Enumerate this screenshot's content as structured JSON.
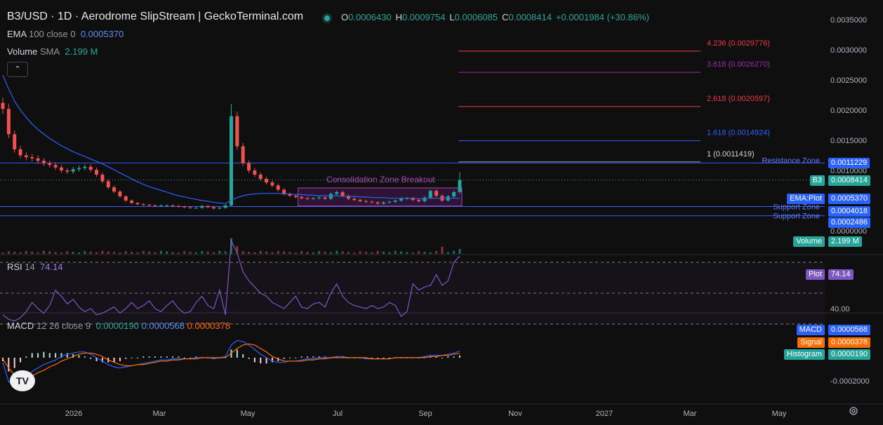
{
  "header": {
    "title": "B3/USD · 1D · Aerodrome SlipStream | GeckoTerminal.com",
    "ohlc": [
      {
        "k": "O",
        "v": "0.0006430"
      },
      {
        "k": "H",
        "v": "0.0009754"
      },
      {
        "k": "L",
        "v": "0.0006085"
      },
      {
        "k": "C",
        "v": "0.0008414"
      }
    ],
    "change": "+0.0001984 (+30.86%)"
  },
  "indicators": {
    "ema": {
      "name": "EMA",
      "params": "100 close 0",
      "value": "0.0005370"
    },
    "volume": {
      "name": "Volume",
      "params": "SMA",
      "value": "2.199 M"
    },
    "rsi": {
      "name": "RSI",
      "params": "14",
      "value": "74.14"
    },
    "macd": {
      "name": "MACD",
      "params": "12 26 close 9",
      "v1": "0.0000190",
      "v2": "0.0000568",
      "v3": "0.0000378"
    }
  },
  "collapse_icon": "chevron-up-icon",
  "colors": {
    "up": "#26a69a",
    "down": "#ef5350",
    "ema": "#2962ff",
    "zone": "#3d5afe",
    "fib_red": "#f23645",
    "fib_purple": "#9c27b0",
    "fib_blue": "#2962ff",
    "rsi": "#7e57c2",
    "macd": "#2962ff",
    "signal": "#ff6d00"
  },
  "chart_data": [
    {
      "type": "candlestick",
      "title": "B3/USD · 1D · Aerodrome SlipStream | GeckoTerminal.com",
      "x_ticks": [
        "2026",
        "Mar",
        "May",
        "Jul",
        "Sep",
        "Nov",
        "2027",
        "Mar",
        "May"
      ],
      "y_ticks": [
        "0.0035000",
        "0.0030000",
        "0.0025000",
        "0.0020000",
        "0.0015000",
        "0.0010000",
        "0.0000000"
      ],
      "ylim": [
        0,
        0.0036
      ],
      "ohlc_last": {
        "open": 0.000643,
        "high": 0.0009754,
        "low": 0.0006085,
        "close": 0.0008414
      },
      "close_series": [
        0.00202,
        0.0016,
        0.00135,
        0.00125,
        0.00122,
        0.0012,
        0.00116,
        0.00112,
        0.00109,
        0.00105,
        0.001,
        0.00098,
        0.00102,
        0.00104,
        0.00106,
        0.00101,
        0.00093,
        0.00082,
        0.00072,
        0.00065,
        0.00057,
        0.0005,
        0.00046,
        0.00044,
        0.00043,
        0.00042,
        0.00041,
        0.00042,
        0.00042,
        0.00041,
        0.0004,
        0.00039,
        0.00038,
        0.00038,
        0.00041,
        0.00039,
        0.00037,
        0.00038,
        0.00042,
        0.0019,
        0.0014,
        0.00112,
        0.001,
        0.00093,
        0.00086,
        0.0008,
        0.00075,
        0.00068,
        0.00061,
        0.00058,
        0.00056,
        0.00054,
        0.00053,
        0.00054,
        0.00055,
        0.00053,
        0.00061,
        0.00064,
        0.00058,
        0.00053,
        0.00051,
        0.00049,
        0.00048,
        0.00047,
        0.00045,
        0.00047,
        0.00048,
        0.0005,
        0.00053,
        0.00054,
        0.00051,
        0.00049,
        0.00055,
        0.00066,
        0.00058,
        0.0005,
        0.00057,
        0.00064,
        0.00084
      ],
      "ema_series": [
        0.00258,
        0.00235,
        0.00215,
        0.002,
        0.00188,
        0.00177,
        0.00168,
        0.0016,
        0.00153,
        0.00147,
        0.00141,
        0.00136,
        0.00131,
        0.00127,
        0.00123,
        0.00119,
        0.00115,
        0.00111,
        0.00106,
        0.00101,
        0.00096,
        0.00091,
        0.00086,
        0.00081,
        0.00077,
        0.00073,
        0.0007,
        0.00067,
        0.00064,
        0.00061,
        0.00058,
        0.00056,
        0.00054,
        0.00052,
        0.0005,
        0.00049,
        0.00047,
        0.00046,
        0.00045,
        0.00051,
        0.00055,
        0.00058,
        0.0006,
        0.00061,
        0.00062,
        0.00062,
        0.00062,
        0.00062,
        0.00061,
        0.00061,
        0.0006,
        0.0006,
        0.00059,
        0.00059,
        0.00058,
        0.00058,
        0.00058,
        0.00058,
        0.00057,
        0.00057,
        0.00057,
        0.00056,
        0.00056,
        0.00055,
        0.00055,
        0.00055,
        0.00054,
        0.00054,
        0.00054,
        0.00054,
        0.00054,
        0.00053,
        0.00053,
        0.00054,
        0.00054,
        0.00054,
        0.00054,
        0.00054,
        0.000537
      ],
      "fib_levels": [
        {
          "label": "4.236 (0.0029776)",
          "value": 0.0029776,
          "color": "#f23645"
        },
        {
          "label": "3.618 (0.0026270)",
          "value": 0.002627,
          "color": "#9c27b0"
        },
        {
          "label": "2.618 (0.0020597)",
          "value": 0.0020597,
          "color": "#f23645"
        },
        {
          "label": "1.618 (0.0014924)",
          "value": 0.0014924,
          "color": "#2962ff"
        },
        {
          "label": "1 (0.0011419)",
          "value": 0.0011419,
          "color": "#9598a1"
        }
      ],
      "zones": [
        {
          "label": "Resistance Zone",
          "value": 0.0011229,
          "tag": "0.0011229"
        },
        {
          "label": "Support Zone",
          "value": 0.0004018,
          "tag": "0.0004018"
        },
        {
          "label": "Support Zone",
          "value": 0.0002486,
          "tag": "0.0002486"
        }
      ],
      "annotation": {
        "text": "Consolidation Zone Breakout",
        "x_start_index": 51,
        "x_end_index": 78,
        "y_low": 0.00041,
        "y_high": 0.00071
      },
      "price_tags": [
        {
          "label": "B3",
          "value": "0.0008414",
          "price": 0.0008414
        },
        {
          "label": "EMA:Plot",
          "value": "0.0005370",
          "price": 0.000537
        }
      ],
      "volume": {
        "label": "Volume",
        "value": "2.199 M",
        "spikes": [
          {
            "index": 39,
            "value": 7.0
          },
          {
            "index": 40,
            "value": 3.5
          },
          {
            "index": 75,
            "value": 3.2
          },
          {
            "index": 78,
            "value": 2.2
          }
        ]
      }
    },
    {
      "type": "line",
      "title": "RSI 14",
      "value": 74.14,
      "levels": [
        70,
        50,
        30
      ],
      "y_ticks": [
        "40.00"
      ],
      "ylim": [
        25,
        85
      ],
      "tag": {
        "label": "Plot",
        "value": "74.14"
      },
      "series": [
        36,
        33,
        32,
        34,
        38,
        44,
        40,
        37,
        42,
        52,
        48,
        43,
        46,
        41,
        38,
        40,
        36,
        37,
        39,
        41,
        37,
        40,
        44,
        40,
        42,
        45,
        40,
        38,
        42,
        45,
        40,
        37,
        38,
        44,
        48,
        42,
        40,
        52,
        36,
        84,
        76,
        64,
        58,
        54,
        50,
        48,
        44,
        42,
        40,
        44,
        48,
        41,
        40,
        43,
        44,
        41,
        50,
        56,
        48,
        44,
        42,
        41,
        40,
        42,
        40,
        41,
        44,
        42,
        35,
        38,
        56,
        52,
        54,
        55,
        62,
        55,
        58,
        70,
        74
      ]
    },
    {
      "type": "line",
      "title": "MACD 12 26 close 9",
      "y_ticks": [
        "-0.0002000"
      ],
      "ylim": [
        -0.00034,
        0.0002
      ],
      "tags": [
        {
          "label": "MACD",
          "value": "0.0000568"
        },
        {
          "label": "Signal",
          "value": "0.0000378"
        },
        {
          "label": "Histogram",
          "value": "0.0000190"
        }
      ],
      "macd": [
        -4e-05,
        -0.00021,
        -0.00024,
        -0.00022,
        -0.00017,
        -0.00012,
        -9e-05,
        -6e-05,
        -4e-05,
        -2e-05,
        1e-05,
        3e-05,
        4e-05,
        5e-05,
        5e-05,
        3e-05,
        0.0,
        -3e-05,
        -6e-05,
        -8e-05,
        -9e-05,
        -8e-05,
        -7e-05,
        -6e-05,
        -5e-05,
        -4e-05,
        -3e-05,
        -2e-05,
        -2e-05,
        -1e-05,
        -1e-05,
        -1e-05,
        -1e-05,
        0.0,
        0.0,
        0.0,
        -1e-05,
        0.0,
        1e-05,
        0.00011,
        0.00015,
        0.00014,
        0.00011,
        7e-05,
        3e-05,
        0.0,
        -3e-05,
        -4e-05,
        -4e-05,
        -3e-05,
        -3e-05,
        -2e-05,
        -1e-05,
        -1e-05,
        0.0,
        0.0,
        0.0,
        1e-05,
        1e-05,
        0.0,
        0.0,
        0.0,
        -1e-05,
        -1e-05,
        -1e-05,
        -1e-05,
        -1e-05,
        0.0,
        0.0,
        0.0,
        0.0,
        0.0,
        1e-05,
        2e-05,
        2e-05,
        2e-05,
        3e-05,
        4e-05,
        5.68e-05
      ],
      "signal": [
        -1e-05,
        -9e-05,
        -0.00015,
        -0.00018,
        -0.00018,
        -0.00016,
        -0.00013,
        -0.00011,
        -8e-05,
        -6e-05,
        -3e-05,
        -1e-05,
        1e-05,
        3e-05,
        4e-05,
        4e-05,
        3e-05,
        1e-05,
        -2e-05,
        -4e-05,
        -6e-05,
        -7e-05,
        -7e-05,
        -6e-05,
        -6e-05,
        -5e-05,
        -4e-05,
        -3e-05,
        -3e-05,
        -2e-05,
        -2e-05,
        -1e-05,
        -1e-05,
        -1e-05,
        0.0,
        0.0,
        0.0,
        0.0,
        0.0,
        4e-05,
        8e-05,
        0.00011,
        0.00012,
        0.00011,
        8e-05,
        5e-05,
        1e-05,
        -1e-05,
        -3e-05,
        -3e-05,
        -3e-05,
        -3e-05,
        -2e-05,
        -2e-05,
        -1e-05,
        -1e-05,
        0.0,
        0.0,
        0.0,
        0.0,
        0.0,
        0.0,
        0.0,
        -1e-05,
        -1e-05,
        -1e-05,
        -1e-05,
        0.0,
        0.0,
        0.0,
        0.0,
        0.0,
        0.0,
        1e-05,
        1e-05,
        2e-05,
        2e-05,
        3e-05,
        3.78e-05
      ]
    }
  ]
}
